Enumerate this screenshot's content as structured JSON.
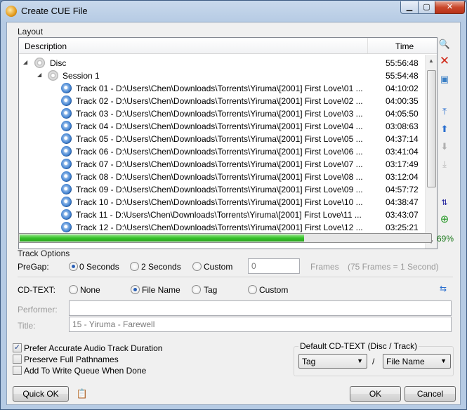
{
  "window": {
    "title": "Create CUE File"
  },
  "layout": {
    "group_label": "Layout",
    "columns": {
      "description": "Description",
      "time": "Time"
    },
    "disc": {
      "label": "Disc",
      "time": "55:56:48"
    },
    "session": {
      "label": "Session 1",
      "time": "55:54:48"
    },
    "tracks": [
      {
        "label": "Track 01 - D:\\Users\\Chen\\Downloads\\Torrents\\Yiruma\\[2001] First Love\\01 ...",
        "time": "04:10:02"
      },
      {
        "label": "Track 02 - D:\\Users\\Chen\\Downloads\\Torrents\\Yiruma\\[2001] First Love\\02 ...",
        "time": "04:00:35"
      },
      {
        "label": "Track 03 - D:\\Users\\Chen\\Downloads\\Torrents\\Yiruma\\[2001] First Love\\03 ...",
        "time": "04:05:50"
      },
      {
        "label": "Track 04 - D:\\Users\\Chen\\Downloads\\Torrents\\Yiruma\\[2001] First Love\\04 ...",
        "time": "03:08:63"
      },
      {
        "label": "Track 05 - D:\\Users\\Chen\\Downloads\\Torrents\\Yiruma\\[2001] First Love\\05 ...",
        "time": "04:37:14"
      },
      {
        "label": "Track 06 - D:\\Users\\Chen\\Downloads\\Torrents\\Yiruma\\[2001] First Love\\06 ...",
        "time": "03:41:04"
      },
      {
        "label": "Track 07 - D:\\Users\\Chen\\Downloads\\Torrents\\Yiruma\\[2001] First Love\\07 ...",
        "time": "03:17:49"
      },
      {
        "label": "Track 08 - D:\\Users\\Chen\\Downloads\\Torrents\\Yiruma\\[2001] First Love\\08 ...",
        "time": "03:12:04"
      },
      {
        "label": "Track 09 - D:\\Users\\Chen\\Downloads\\Torrents\\Yiruma\\[2001] First Love\\09 ...",
        "time": "04:57:72"
      },
      {
        "label": "Track 10 - D:\\Users\\Chen\\Downloads\\Torrents\\Yiruma\\[2001] First Love\\10 ...",
        "time": "04:38:47"
      },
      {
        "label": "Track 11 - D:\\Users\\Chen\\Downloads\\Torrents\\Yiruma\\[2001] First Love\\11 ...",
        "time": "03:43:07"
      },
      {
        "label": "Track 12 - D:\\Users\\Chen\\Downloads\\Torrents\\Yiruma\\[2001] First Love\\12 ...",
        "time": "03:25:21"
      }
    ],
    "progress": {
      "fraction": 0.69,
      "label": "69%"
    }
  },
  "side_toolbar": [
    "open-icon",
    "delete-icon",
    "clear-icon",
    "move-top-icon",
    "move-up-icon",
    "move-down-icon",
    "move-bottom-icon",
    "sort-icon",
    "add-icon"
  ],
  "track_options": {
    "group_label": "Track Options",
    "pregap_label": "PreGap:",
    "pregap_options": [
      "0 Seconds",
      "2 Seconds",
      "Custom"
    ],
    "pregap_selected": 0,
    "custom_value": "0",
    "frames_label": "Frames",
    "frames_hint": "(75 Frames = 1 Second)",
    "cdtext_label": "CD-TEXT:",
    "cdtext_options": [
      "None",
      "File Name",
      "Tag",
      "Custom"
    ],
    "cdtext_selected": 1,
    "performer_label": "Performer:",
    "performer_value": "",
    "title_label": "Title:",
    "title_value": "15 - Yiruma - Farewell"
  },
  "checks": [
    {
      "label": "Prefer Accurate Audio Track Duration",
      "checked": true
    },
    {
      "label": "Preserve Full Pathnames",
      "checked": false
    },
    {
      "label": "Add To Write Queue When Done",
      "checked": false
    }
  ],
  "default_cdtext": {
    "label": "Default CD-TEXT (Disc / Track)",
    "disc_value": "Tag",
    "separator": "/",
    "track_value": "File Name"
  },
  "buttons": {
    "quick_ok": "Quick OK",
    "ok": "OK",
    "cancel": "Cancel"
  }
}
